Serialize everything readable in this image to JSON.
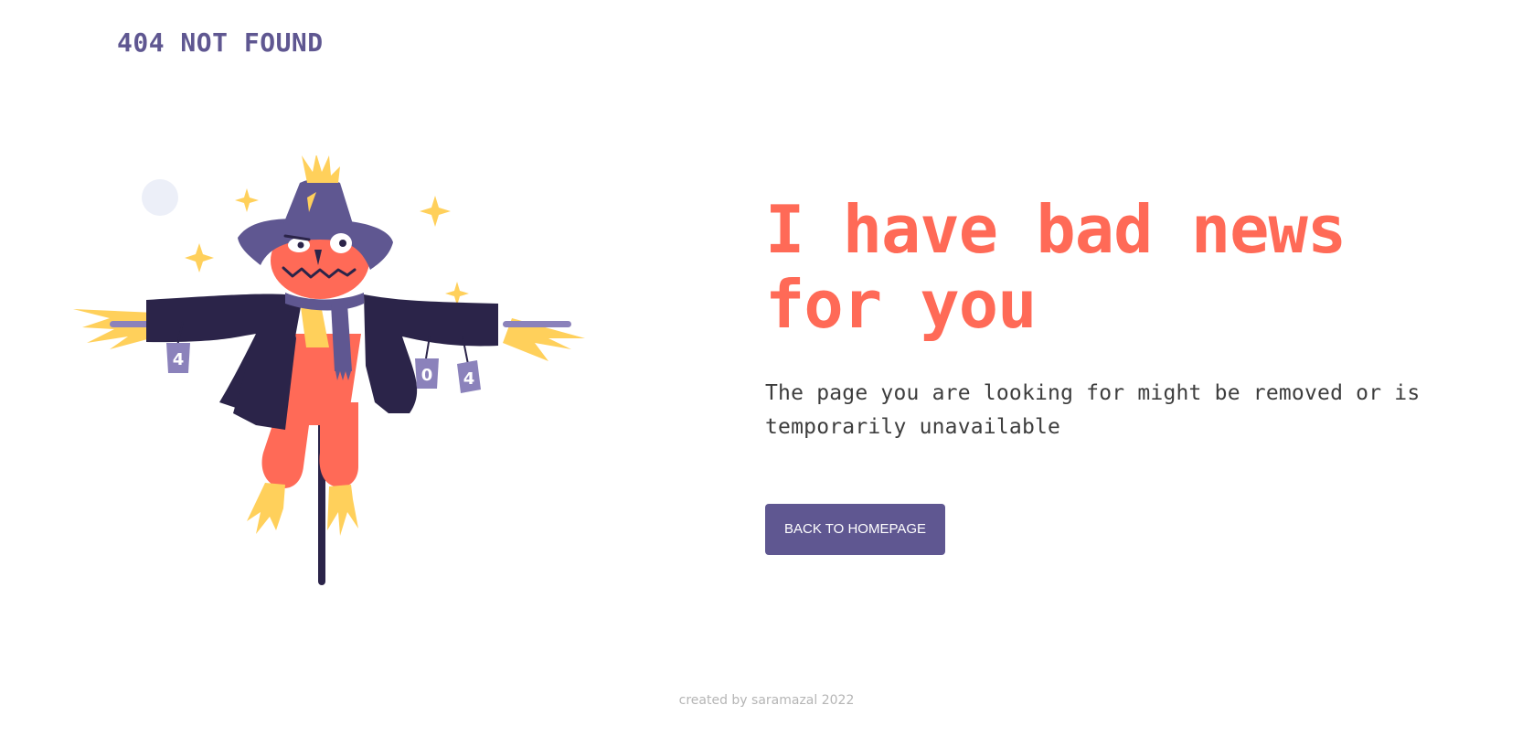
{
  "header": {
    "logo_text": "404 NOT FOUND"
  },
  "main": {
    "headline": "I have bad news for you",
    "description": "The page you are looking for might be removed or is temporarily unavailable",
    "cta_label": "BACK TO HOMEPAGE"
  },
  "illustration": {
    "subject": "scarecrow",
    "can_labels": [
      "4",
      "0",
      "4"
    ]
  },
  "footer": {
    "credit": "created by saramazal 2022"
  },
  "colors": {
    "brand_purple": "#5f5791",
    "accent_coral": "#ff6a57",
    "straw_yellow": "#ffd05b",
    "coat_navy": "#2b2449"
  }
}
